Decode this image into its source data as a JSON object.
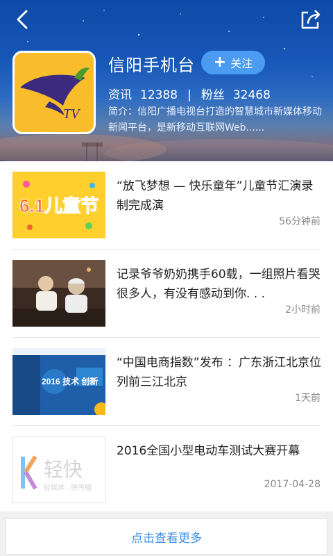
{
  "header": {
    "back_icon": "back-chevron-icon",
    "share_icon": "share-icon",
    "channel_name": "信阳手机台",
    "follow_label": "关注",
    "stats": {
      "articles_label": "资讯",
      "articles_count": "12388",
      "separator": "|",
      "fans_label": "粉丝",
      "fans_count": "32468"
    },
    "intro": "简介：信阳广播电视台打造的智慧城市新媒体移动新闻平台，是新移动互联网Web......",
    "logo_text": "TV"
  },
  "articles": [
    {
      "title": "“放飞梦想 — 快乐童年”儿童节汇演录制完成演",
      "time": "56分钟前",
      "thumb_text": "6.1儿童节"
    },
    {
      "title": "记录爷爷奶奶携手60载，一组照片看哭很多人，有没有感动到你. . .",
      "time": "2小时前"
    },
    {
      "title": "“中国电商指数”发布 ：广东浙江北京位列前三江北京",
      "time": "1天前",
      "thumb_text": "2016 技术 创新"
    },
    {
      "title": "2016全国小型电动车测试大赛开幕",
      "time": "2017-04-28",
      "thumb_text": "轻快",
      "thumb_subtext": "轻媒体 · 快传播"
    }
  ],
  "footer": {
    "more_label": "点击查看更多"
  },
  "colors": {
    "accent": "#3c8ee6",
    "follow_bg": "#4b9bf0",
    "logo_bg": "#f9bd2b"
  }
}
